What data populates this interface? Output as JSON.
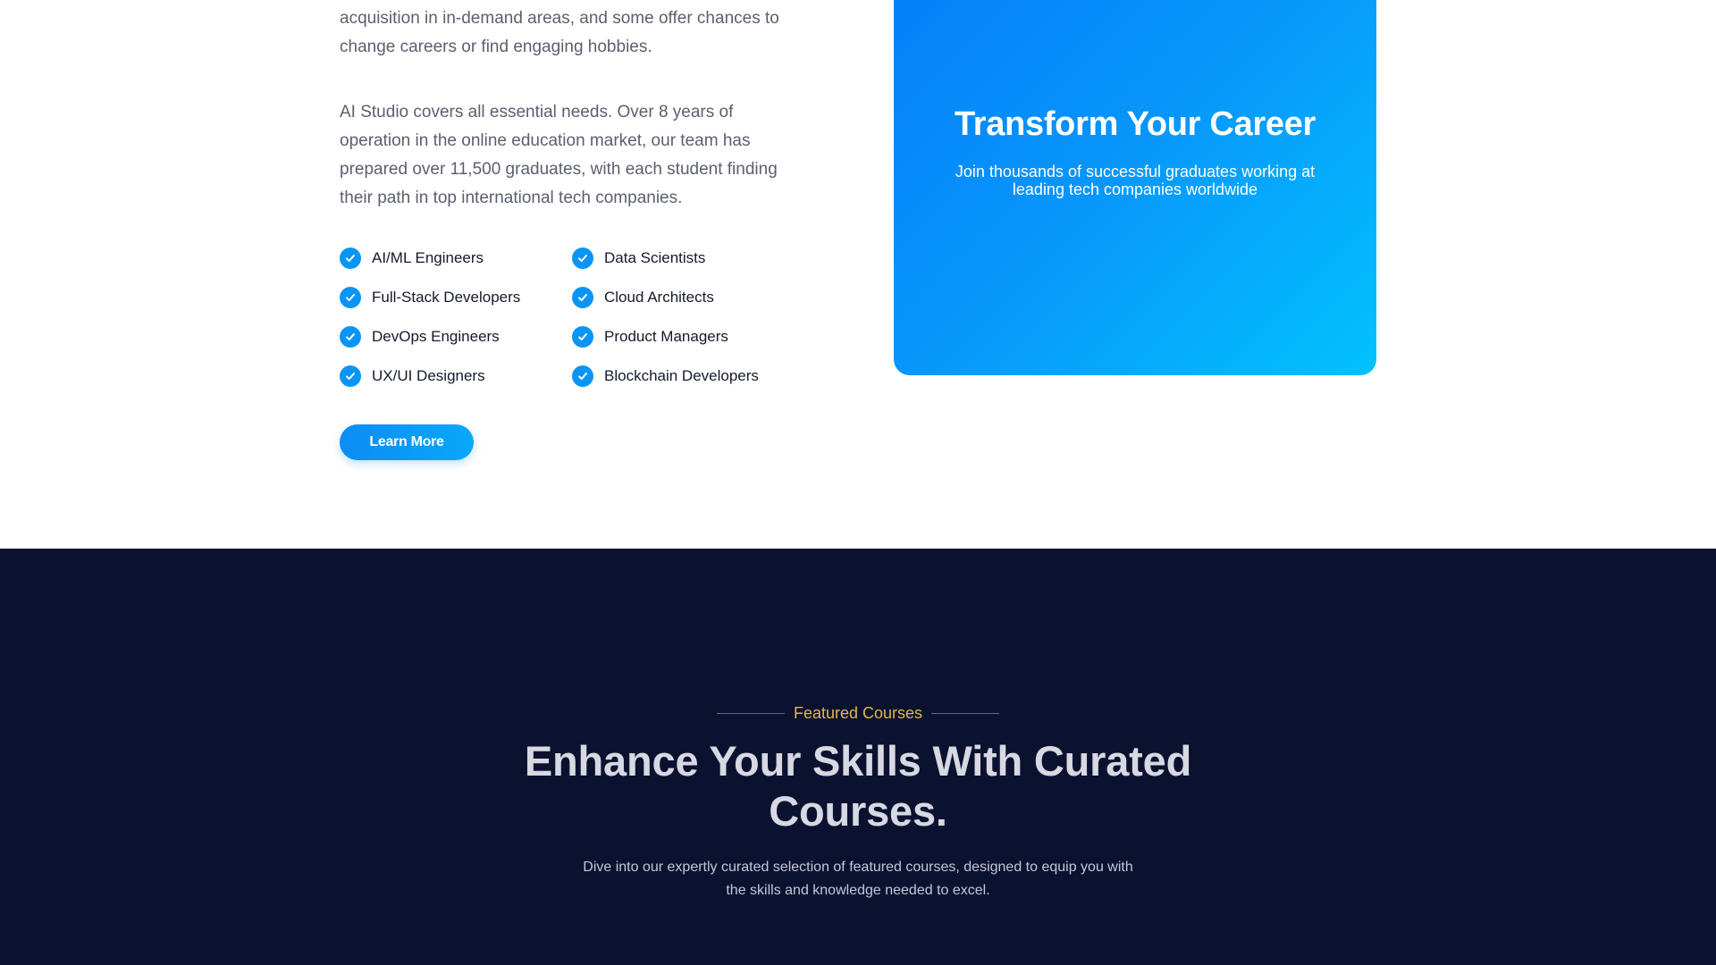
{
  "about": {
    "paragraph1": "acquisition in in-demand areas, and some offer chances to change careers or find engaging hobbies.",
    "paragraph2": "AI Studio covers all essential needs. Over 8 years of operation in the online education market, our team has prepared over 11,500 graduates, with each student finding their path in top international tech companies.",
    "features": [
      "AI/ML Engineers",
      "Data Scientists",
      "Full-Stack Developers",
      "Cloud Architects",
      "DevOps Engineers",
      "Product Managers",
      "UX/UI Designers",
      "Blockchain Developers"
    ],
    "learn_more_label": "Learn More"
  },
  "career_card": {
    "title": "Transform Your Career",
    "subtitle": "Join thousands of successful graduates working at leading tech companies worldwide"
  },
  "courses": {
    "eyebrow": "Featured Courses",
    "title": "Enhance Your Skills With Curated Courses.",
    "subtitle": "Dive into our expertly curated selection of featured courses, designed to equip you with the skills and knowledge needed to excel."
  },
  "icons": {
    "feature_check": "check-circle-icon"
  },
  "colors": {
    "accent_blue": "#0a95f5",
    "dark_navy": "#0b1230",
    "eyebrow_gold": "#e3b54a"
  }
}
